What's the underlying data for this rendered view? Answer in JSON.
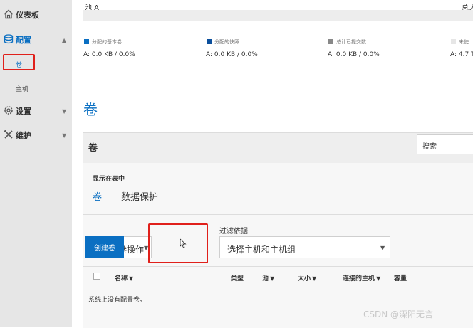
{
  "sidebar": {
    "dashboard": "仪表板",
    "config": "配置",
    "config_items": [
      "卷",
      "主机"
    ],
    "settings": "设置",
    "maintenance": "维护",
    "icons": [
      "home-icon",
      "database-icon",
      "gear-icon",
      "tools-icon"
    ]
  },
  "pool": {
    "name": "池 A",
    "total_label": "总大"
  },
  "stats": [
    {
      "label": "分配的基本卷",
      "value": "A: 0.0 KB / 0.0%",
      "color": "#0a6fc2"
    },
    {
      "label": "分配的快照",
      "value": "A: 0.0 KB / 0.0%",
      "color": "#0b4f9c"
    },
    {
      "label": "总计已提交数",
      "value": "A: 0.0 KB / 0.0%",
      "color": "#888888"
    },
    {
      "label": "未使",
      "value": "A: 4.7 T",
      "color": "#e6e6e6"
    }
  ],
  "page_title": "卷",
  "panel": {
    "title": "卷",
    "search_label": "搜索",
    "display_label": "显示在表中",
    "tab_volume": "卷",
    "tab_protection": "数据保护",
    "action_select": "选择卷操作",
    "create_button": "创建卷",
    "filter_label": "过滤依据",
    "filter_select": "选择主机和主机组",
    "columns": [
      "名称",
      "类型",
      "池",
      "大小",
      "连接的主机",
      "容量"
    ],
    "empty_message": "系统上没有配置卷。"
  },
  "watermark": "CSDN @溧阳无言",
  "colors": {
    "accent": "#0a6fc2",
    "highlight": "#e0201b",
    "sidebar": "#e6e6e6"
  }
}
